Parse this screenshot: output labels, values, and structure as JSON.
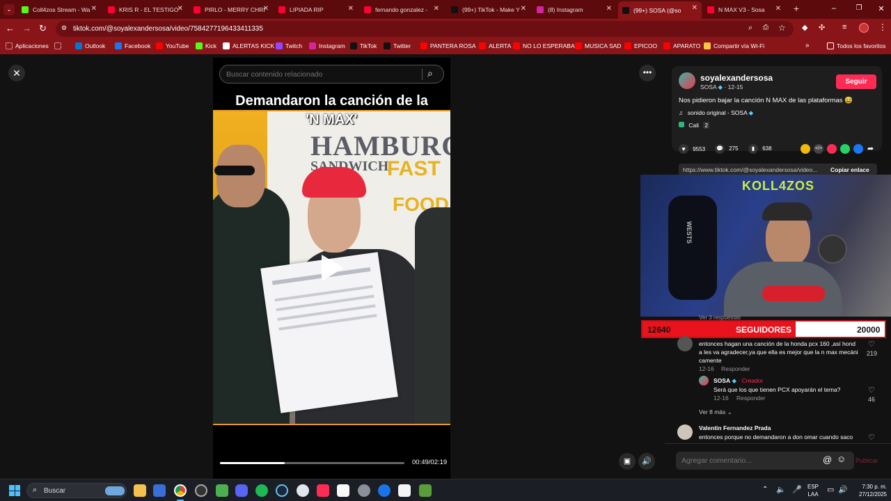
{
  "tabs": [
    {
      "title": "Coll4zos Stream - Wa",
      "color": "#53fc18",
      "glyph": "K"
    },
    {
      "title": "KRIS R - EL TESTIGO",
      "color": "#ff0033",
      "glyph": "▶"
    },
    {
      "title": "PIRLO - MERRY CHRI",
      "color": "#ff0033",
      "glyph": "▶"
    },
    {
      "title": "LIPIADA RIP",
      "color": "#ff0033",
      "glyph": "▶"
    },
    {
      "title": "fernando gonzalez -",
      "color": "#ff0033",
      "glyph": "▶"
    },
    {
      "title": "(99+) TikTok - Make Y",
      "color": "#111111",
      "glyph": "♪"
    },
    {
      "title": "(8) Instagram",
      "color": "#d6249f",
      "glyph": "◎"
    },
    {
      "title": "(99+) SOSA (@so",
      "color": "#111111",
      "glyph": "♪"
    },
    {
      "title": "N MAX V3 - Sosa",
      "color": "#ff0033",
      "glyph": "▶"
    }
  ],
  "address": {
    "url": "tiktok.com/@soyalexandersosa/video/7584277196433411335"
  },
  "bookmarks": [
    {
      "label": "Aplicaciones",
      "color": "#ffffff"
    },
    {
      "label": "",
      "color": "#ffffff"
    },
    {
      "label": "Outlook",
      "color": "#0078d4"
    },
    {
      "label": "Facebook",
      "color": "#1877f2"
    },
    {
      "label": "YouTube",
      "color": "#ff0000"
    },
    {
      "label": "Kick",
      "color": "#53fc18"
    },
    {
      "label": "ALERTAS KICK",
      "color": "#ffffff"
    },
    {
      "label": "Twitch",
      "color": "#9146ff"
    },
    {
      "label": "Instagram",
      "color": "#d6249f"
    },
    {
      "label": "TikTok",
      "color": "#111111"
    },
    {
      "label": "Twitter",
      "color": "#111111"
    },
    {
      "label": "PANTERA ROSA",
      "color": "#ff0000"
    },
    {
      "label": "ALERTA",
      "color": "#ff0000"
    },
    {
      "label": "NO LO ESPERABA",
      "color": "#ff0000"
    },
    {
      "label": "MUSICA SAD",
      "color": "#ff0000"
    },
    {
      "label": "EPICOO",
      "color": "#ff0000"
    },
    {
      "label": "APARATO",
      "color": "#ff0000"
    },
    {
      "label": "Compartir vía Wi-Fi",
      "color": "#f4c542"
    }
  ],
  "bookmarks_all": "Todos los favoritos",
  "search": {
    "placeholder": "Buscar contenido relacionado"
  },
  "video": {
    "caption_line1": "Demandaron la canción de la",
    "caption_line2": "'N MAX'",
    "time": "00:49/02:19",
    "progress": 0.35,
    "sign_line1": "HAMBURGU",
    "sign_line2": "SANDWICH",
    "sign_line3": "FAST",
    "sign_line4": "FOOD"
  },
  "author": {
    "username": "soyalexandersosa",
    "display": "SOSA",
    "date": "12-15",
    "follow_label": "Seguir",
    "description": "Nos pidieron bajar la canción N MAX de las plataformas 😅",
    "sound": "sonido original - SOSA",
    "location": "Cali",
    "location_count": "2"
  },
  "stats": {
    "likes": "9553",
    "comments": "275",
    "saves": "638"
  },
  "link": {
    "url": "https://www.tiktok.com/@soyalexandersosa/video...",
    "copy_label": "Copiar enlace"
  },
  "overlay": {
    "brand": "KOLL4ZOS",
    "followers_current": "12640",
    "followers_label": "SEGUIDORES",
    "followers_goal": "20000",
    "followers_progress": 0.632,
    "chair_text": "WESTS"
  },
  "comments": {
    "replies_hidden": "Ver 3 respuestas",
    "c1_text": "entonces hagan una canción de la honda pcx 160 ,así hond a les va agradecer,ya que ella es mejor que la n max mecáni camente",
    "c1_date": "12-16",
    "c1_reply": "Responder",
    "c1_likes": "219",
    "r1_name": "SOSA",
    "r1_badge": "· Creador",
    "r1_text": "Será que los que tienen PCX apoyarán el tema?",
    "r1_date": "12-16",
    "r1_reply": "Responder",
    "r1_likes": "46",
    "more": "Ver 8 más",
    "c2_name": "Valentin Fernandez Prada",
    "c2_text": "entonces porque no demandaron a don omar cuando saco"
  },
  "comment_box": {
    "placeholder": "Agregar comentario...",
    "post": "Publicar"
  },
  "taskbar": {
    "search": "Buscar",
    "lang1": "ESP",
    "lang2": "LAA",
    "time": "7:30 p. m.",
    "date": "27/12/2025"
  },
  "colors": {
    "tiktok_red": "#fe2c55",
    "chrome_frame": "#8a1519",
    "chrome_tabs": "#5d0a0c"
  }
}
